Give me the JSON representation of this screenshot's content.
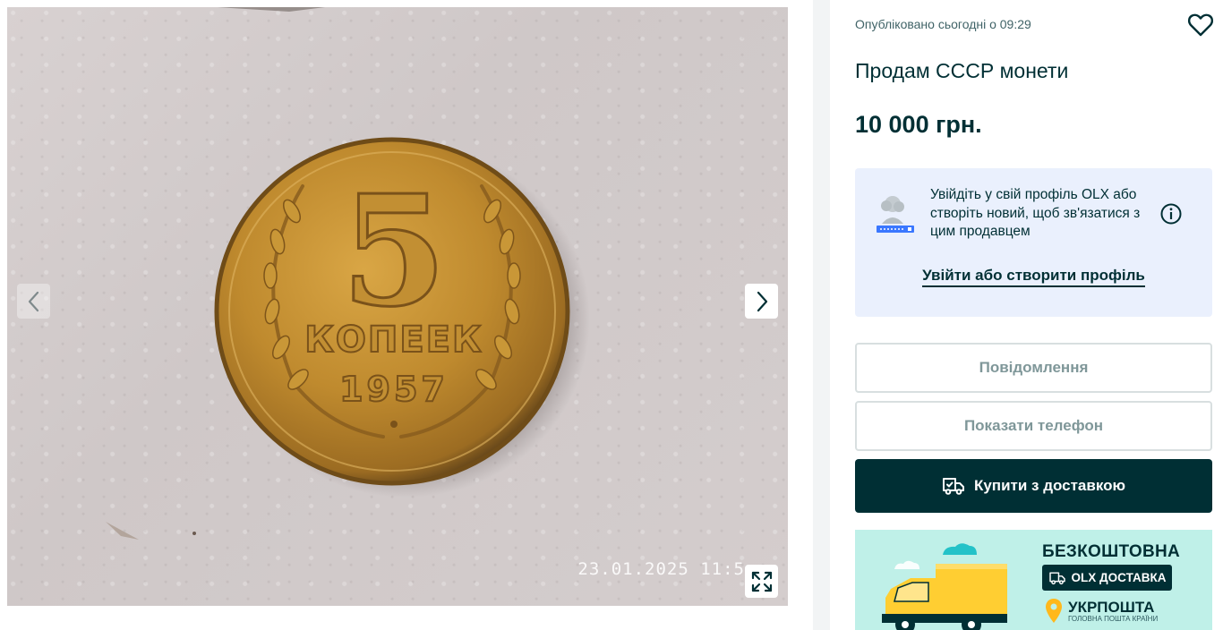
{
  "gallery": {
    "photo_alt": "5 копеек 1957 coin",
    "coin_denomination": "5",
    "coin_word": "КОПЕЕК",
    "coin_year": "1957",
    "photo_timestamp": "23.01.2025  11:5",
    "prev_icon": "chevron-left-icon",
    "next_icon": "chevron-right-icon",
    "fullscreen_icon": "expand-icon"
  },
  "listing": {
    "published": "Опубліковано сьогодні о 09:29",
    "title": "Продам СССР монети",
    "price": "10 000 грн.",
    "favorite_icon": "heart-icon"
  },
  "login_prompt": {
    "text": "Увійдіть у свій профіль OLX або створіть новий, щоб зв'язатися з цим продавцем",
    "link": "Увійти або створити профіль",
    "info_icon": "info-icon"
  },
  "actions": {
    "message": "Повідомлення",
    "show_phone": "Показати телефон",
    "buy_delivery": "Купити з доставкою",
    "buy_icon": "delivery-truck-icon"
  },
  "promo": {
    "headline": "БЕЗКОШТОВНА",
    "badge": "OLX ДОСТАВКА",
    "carrier": "УКРПОШТА",
    "carrier_tagline": "ГОЛОВНА ПОШТА КРАЇНИ"
  },
  "colors": {
    "brand_dark": "#002f34",
    "login_bg": "#eaf0fd",
    "promo_bg": "#bff0e8",
    "coin_gold": "#b8862b"
  }
}
